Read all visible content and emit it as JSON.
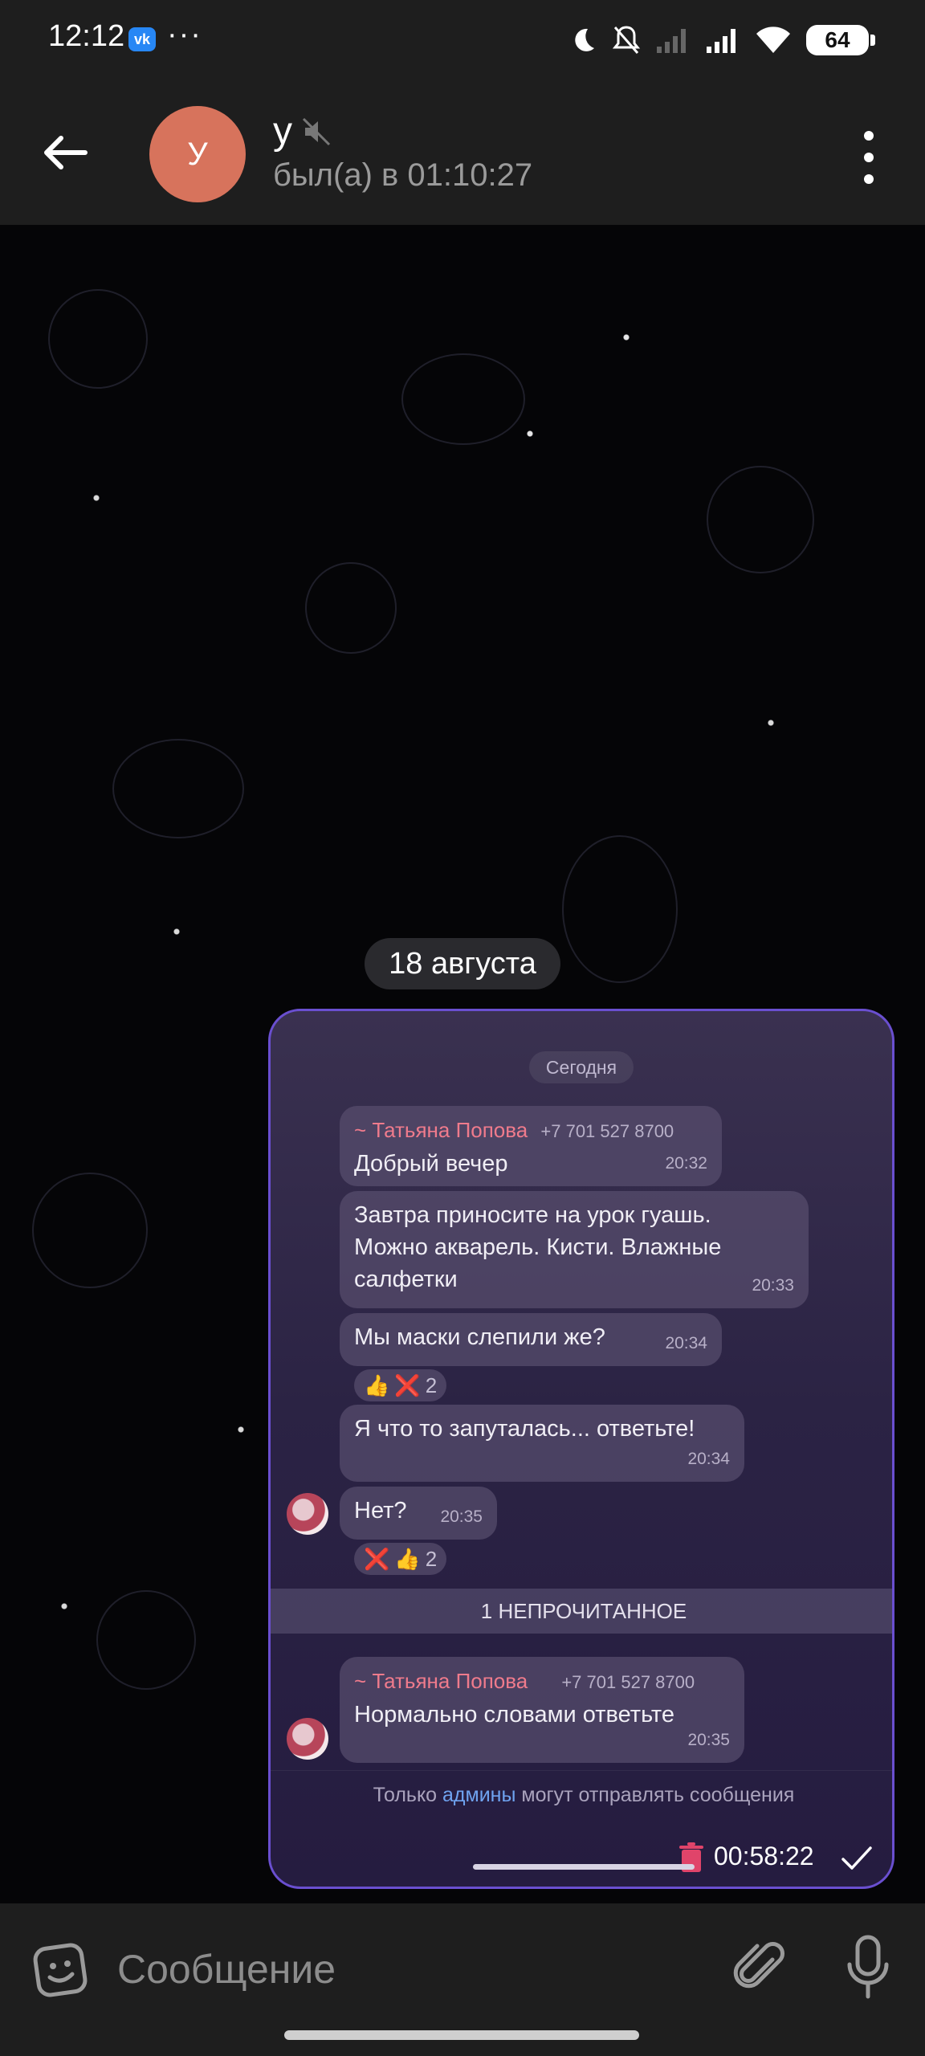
{
  "status_bar": {
    "time": "12:12",
    "vk_label": "vk",
    "more_dots": "···",
    "battery": "64"
  },
  "header": {
    "avatar_letter": "У",
    "title": "у",
    "subtitle": "был(а) в 01:10:27"
  },
  "date_chip": "18 августа",
  "forwarded_screenshot": {
    "date_label": "Сегодня",
    "messages": [
      {
        "sender": "~ Татьяна Попова",
        "phone": "+7 701 527 8700",
        "text": "Добрый вечер",
        "time": "20:32"
      },
      {
        "text_lines": [
          "Завтра приносите на урок гуашь.",
          "Можно акварель. Кисти. Влажные",
          "салфетки"
        ],
        "time": "20:33"
      },
      {
        "text": "Мы маски слепили же?",
        "time": "20:34",
        "reactions": {
          "emoji": [
            "👍",
            "❌"
          ],
          "count": "2"
        }
      },
      {
        "text": "Я что то запуталась... ответьте!",
        "time": "20:34"
      },
      {
        "text": "Нет?",
        "time": "20:35",
        "reactions": {
          "emoji": [
            "❌",
            "👍"
          ],
          "count": "2"
        }
      },
      {
        "sender": "~ Татьяна Попова",
        "phone": "+7 701 527 8700",
        "text": "Нормально словами ответьте",
        "time": "20:35"
      }
    ],
    "unread_label": "1 НЕПРОЧИТАННОЕ",
    "only_admins_pre": "Только ",
    "only_admins_link": "админы",
    "only_admins_post": " могут отправлять сообщения",
    "recording_time": "00:58:22"
  },
  "composer": {
    "placeholder": "Сообщение"
  },
  "colors": {
    "header_bg": "#1e1e1e",
    "avatar": "#d7735c",
    "accent_border": "#6a4fd0",
    "sender_name": "#ef7b8c",
    "link": "#6fa3f0"
  },
  "icons": [
    "back-arrow-icon",
    "mute-icon",
    "more-vertical-icon",
    "emoji-icon",
    "paperclip-icon",
    "microphone-icon",
    "trash-icon",
    "check-icon"
  ]
}
